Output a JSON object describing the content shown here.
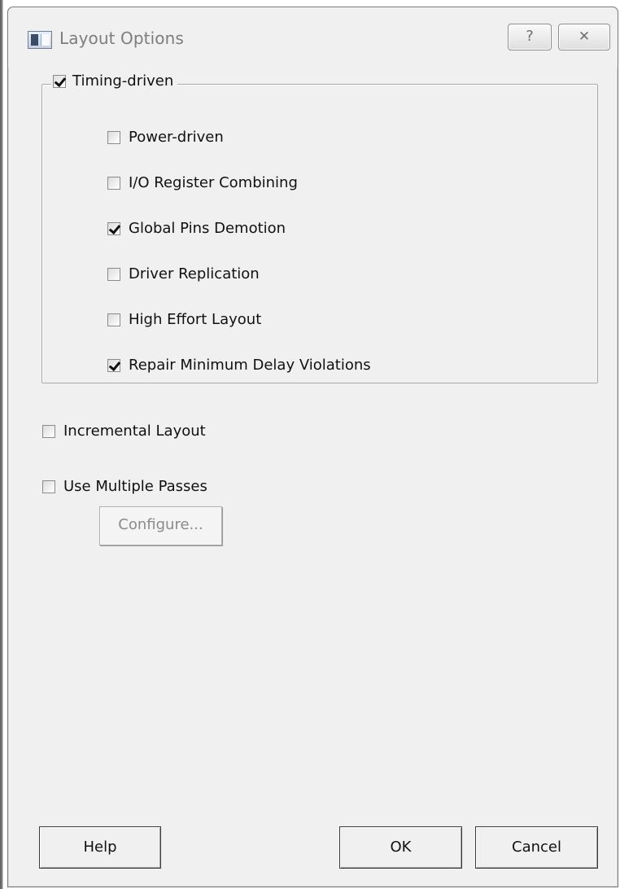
{
  "window": {
    "title": "Layout Options",
    "help_button": "?",
    "close_button": "✕"
  },
  "timing_group": {
    "label": "Timing-driven",
    "checked": true,
    "options": [
      {
        "label": "Power-driven",
        "checked": false
      },
      {
        "label": "I/O Register Combining",
        "checked": false
      },
      {
        "label": "Global Pins Demotion",
        "checked": true
      },
      {
        "label": "Driver Replication",
        "checked": false
      },
      {
        "label": "High Effort Layout",
        "checked": false
      },
      {
        "label": "Repair Minimum Delay Violations",
        "checked": true
      }
    ]
  },
  "incremental_layout": {
    "label": "Incremental Layout",
    "checked": false
  },
  "multiple_passes": {
    "label": "Use Multiple Passes",
    "checked": false
  },
  "configure_button": {
    "label": "Configure...",
    "enabled": false
  },
  "buttons": {
    "help": "Help",
    "ok": "OK",
    "cancel": "Cancel"
  }
}
